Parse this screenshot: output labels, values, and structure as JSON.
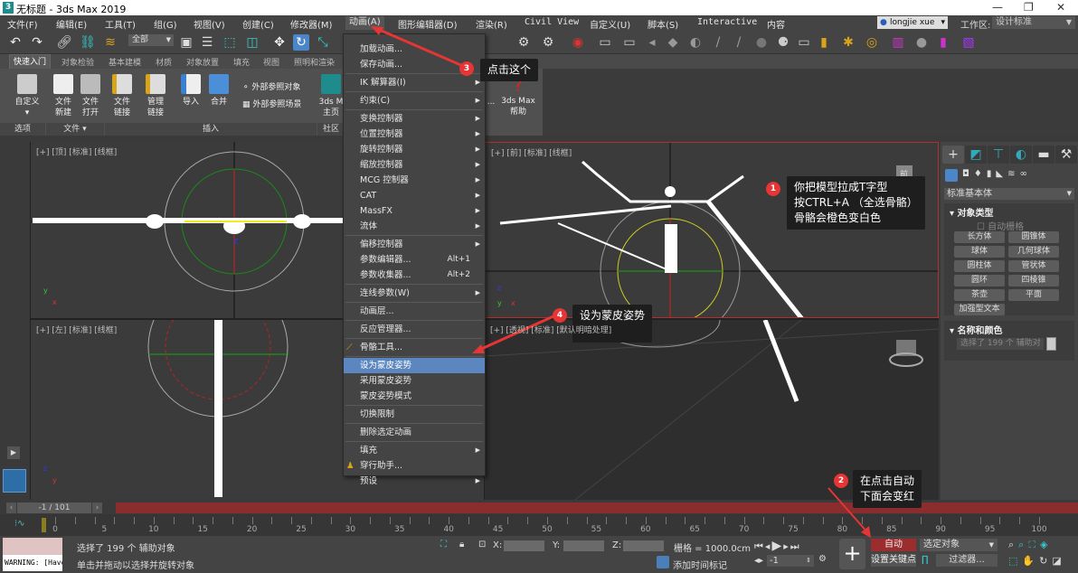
{
  "window": {
    "title": "无标题 - 3ds Max 2019",
    "logo": "3"
  },
  "menu": [
    "文件(F)",
    "编辑(E)",
    "工具(T)",
    "组(G)",
    "视图(V)",
    "创建(C)",
    "修改器(M)",
    "动画(A)",
    "图形编辑器(D)",
    "渲染(R)",
    "Civil View",
    "自定义(U)",
    "脚本(S)",
    "Interactive",
    "内容"
  ],
  "user": "longjie xue",
  "workspace": {
    "label": "工作区:",
    "value": "设计标准"
  },
  "toolbar": {
    "selection_filter": "全部"
  },
  "ribbon": {
    "tabs": [
      "快速入门",
      "对象检验",
      "基本建模",
      "材质",
      "对象放置",
      "填充",
      "视图",
      "照明和渲染"
    ],
    "buttons": [
      "自定义",
      "文件\n新建",
      "文件\n打开",
      "文件\n链接",
      "管理\n链接",
      "导入",
      "合并"
    ],
    "xref": [
      "外部参照对象",
      "外部参照场景"
    ],
    "home": "3ds M\n主页",
    "more": "...",
    "help": "3ds Max\n帮助",
    "groups": [
      "选项",
      "文件 ▾",
      "插入",
      "社区"
    ]
  },
  "animation_menu": [
    {
      "label": "加载动画..."
    },
    {
      "label": "保存动画..."
    },
    {
      "sep": true
    },
    {
      "label": "IK 解算器(I)",
      "sub": true
    },
    {
      "sep": true
    },
    {
      "label": "约束(C)",
      "sub": true
    },
    {
      "sep": true
    },
    {
      "label": "变换控制器",
      "sub": true
    },
    {
      "label": "位置控制器",
      "sub": true
    },
    {
      "label": "旋转控制器",
      "sub": true
    },
    {
      "label": "缩放控制器",
      "sub": true
    },
    {
      "label": "MCG 控制器",
      "sub": true
    },
    {
      "label": "CAT",
      "sub": true
    },
    {
      "label": "MassFX",
      "sub": true
    },
    {
      "label": "流体",
      "sub": true
    },
    {
      "sep": true
    },
    {
      "label": "偏移控制器",
      "sub": true
    },
    {
      "label": "参数编辑器...",
      "shortcut": "Alt+1"
    },
    {
      "label": "参数收集器...",
      "shortcut": "Alt+2"
    },
    {
      "sep": true
    },
    {
      "label": "连线参数(W)",
      "sub": true
    },
    {
      "sep": true
    },
    {
      "label": "动画层..."
    },
    {
      "sep": true
    },
    {
      "label": "反应管理器..."
    },
    {
      "sep": true
    },
    {
      "label": "骨骼工具..."
    },
    {
      "sep": true
    },
    {
      "label": "设为蒙皮姿势",
      "highlight": true
    },
    {
      "label": "采用蒙皮姿势"
    },
    {
      "label": "蒙皮姿势模式"
    },
    {
      "sep": true
    },
    {
      "label": "切换限制"
    },
    {
      "sep": true
    },
    {
      "label": "删除选定动画"
    },
    {
      "sep": true
    },
    {
      "label": "填充",
      "sub": true
    },
    {
      "label": "穿行助手..."
    },
    {
      "label": "预设",
      "sub": true
    }
  ],
  "viewports": {
    "top": "[+] [顶] [标准] [线框]",
    "front": "[+] [前] [标准] [线框]",
    "left": "[+] [左] [标准] [线框]",
    "perspective": "[+] [透视] [标准] [默认明暗处理]",
    "viewcube_front": "前"
  },
  "annotations": [
    {
      "n": "1",
      "text": "你把模型拉成T字型\n按CTRL+A （全选骨骼）\n骨骼会橙色变白色"
    },
    {
      "n": "2",
      "text": "在点击自动\n下面会变红"
    },
    {
      "n": "3",
      "text": "点击这个"
    },
    {
      "n": "4",
      "text": "设为蒙皮姿势"
    }
  ],
  "command_panel": {
    "category": "标准基本体",
    "object_type": {
      "title": "对象类型",
      "autogrid": "自动栅格",
      "buttons": [
        "长方体",
        "圆锥体",
        "球体",
        "几何球体",
        "圆柱体",
        "管状体",
        "圆环",
        "四棱锥",
        "茶壶",
        "平面",
        "加强型文本"
      ]
    },
    "name_color": {
      "title": "名称和颜色",
      "name": "选择了 199 个 辅助对"
    }
  },
  "timeline": {
    "position": "-1 / 101",
    "ticks": [
      0,
      5,
      10,
      15,
      20,
      25,
      30,
      35,
      40,
      45,
      50,
      55,
      60,
      65,
      70,
      75,
      80,
      85,
      90,
      95,
      100
    ],
    "current": -1
  },
  "status": {
    "maxscript": "WARNING: [Havo",
    "selection": "选择了 199 个 辅助对象",
    "prompt": "单击并拖动以选择并旋转对象",
    "x_label": "X:",
    "y_label": "Y:",
    "z_label": "Z:",
    "grid": "栅格 = 1000.0cm",
    "add_time_tag": "添加时间标记",
    "frame": "-1",
    "auto_key": "自动",
    "set_key": "设置关键点",
    "key_filter_set": "选定对象",
    "filters": "过滤器..."
  },
  "colors": {
    "accent": "#5b86c0",
    "auto_key": "#9b2d2f",
    "annotation": "#e53535"
  }
}
